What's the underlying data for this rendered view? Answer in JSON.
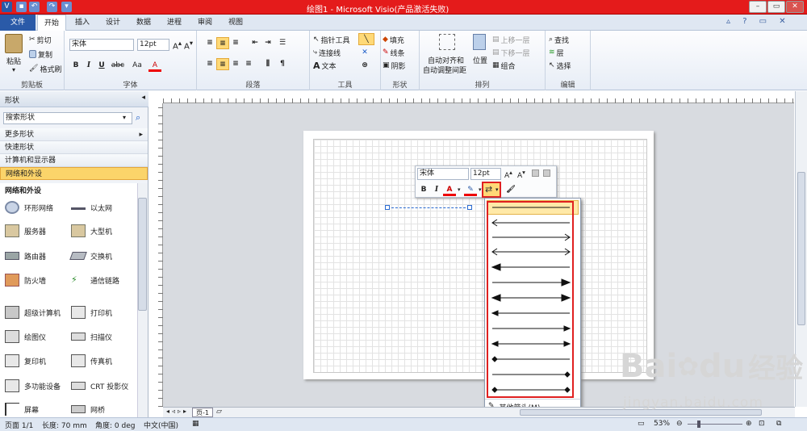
{
  "titlebar": {
    "title": "绘图1 - Microsoft Visio(产品激活失败)",
    "bg": "#e41b1b"
  },
  "quick_access": {
    "icon_letter": "V"
  },
  "tabs": [
    "文件",
    "开始",
    "插入",
    "设计",
    "数据",
    "进程",
    "审阅",
    "视图"
  ],
  "clipboard": {
    "paste": "粘贴",
    "cut": "剪切",
    "copy": "复制",
    "format_painter": "格式刷",
    "label": "剪贴板"
  },
  "font": {
    "name": "宋体",
    "size": "12pt",
    "label": "字体",
    "bold": "B",
    "italic": "I",
    "underline": "U",
    "strike": "abc",
    "case": "Aa",
    "color": "A"
  },
  "paragraph": {
    "label": "段落"
  },
  "tools": {
    "pointer": "指针工具",
    "connector": "连接线",
    "text": "文本",
    "label": "工具"
  },
  "shape_grp": {
    "fill": "填充",
    "line": "线条",
    "shadow": "阴影",
    "label": "形状"
  },
  "arrange": {
    "auto_align": "自动对齐和",
    "auto_space": "自动调整间距",
    "position": "位置",
    "bring_forward": "上移一层",
    "send_backward": "下移一层",
    "group": "组合",
    "label": "排列"
  },
  "editing": {
    "find": "查找",
    "layers": "层",
    "select": "选择",
    "label": "编辑"
  },
  "shapes_pane": {
    "title": "形状",
    "search_placeholder": "搜索形状",
    "more": "更多形状",
    "quick": "快速形状",
    "computers": "计算机和显示器",
    "network": "网络和外设",
    "section": "网络和外设",
    "items": [
      "环形网络",
      "以太网",
      "服务器",
      "大型机",
      "路由器",
      "交换机",
      "防火墙",
      "通信链路",
      "超级计算机",
      "打印机",
      "绘图仪",
      "扫描仪",
      "复印机",
      "传真机",
      "多功能设备",
      "CRT 投影仪",
      "屏幕",
      "网桥"
    ]
  },
  "mini_toolbar": {
    "font": "宋体",
    "size": "12pt"
  },
  "arrow_menu": {
    "more": "其他箭头(M)..."
  },
  "sheet": {
    "tab": "页-1"
  },
  "status": {
    "page": "页面 1/1",
    "length": "长度: 70 mm",
    "angle": "角度: 0 deg",
    "lang": "中文(中国)",
    "zoom": "53%"
  },
  "watermark": {
    "brand": "Bai",
    "brand2": "du",
    "cn": "经验",
    "url": "jingyan.baidu.com"
  }
}
